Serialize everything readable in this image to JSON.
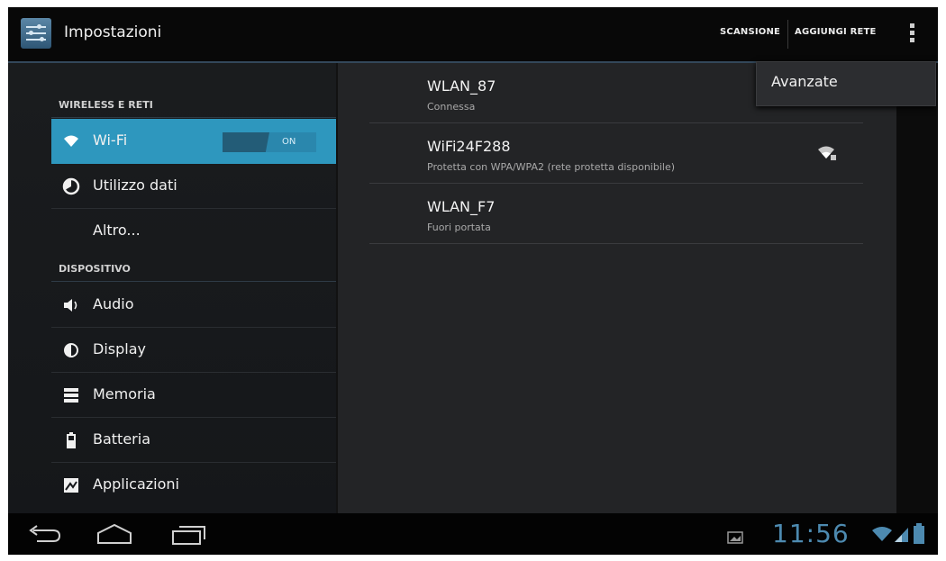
{
  "action_bar": {
    "title": "Impostazioni",
    "scan_label": "SCANSIONE",
    "add_network_label": "AGGIUNGI RETE",
    "icons": [
      "settings-app-icon",
      "overflow-menu-icon"
    ]
  },
  "overflow_menu": {
    "items": [
      {
        "label": "Avanzate"
      }
    ]
  },
  "sidebar": {
    "section_wireless": "WIRELESS E RETI",
    "section_device": "DISPOSITIVO",
    "items": [
      {
        "label": "Wi-Fi",
        "icon": "wifi-icon",
        "selected": true,
        "toggle": "ON"
      },
      {
        "label": "Utilizzo dati",
        "icon": "data-usage-icon"
      },
      {
        "label": "Altro..."
      },
      {
        "label": "Audio",
        "icon": "speaker-icon"
      },
      {
        "label": "Display",
        "icon": "brightness-icon"
      },
      {
        "label": "Memoria",
        "icon": "storage-icon"
      },
      {
        "label": "Batteria",
        "icon": "battery-icon"
      },
      {
        "label": "Applicazioni",
        "icon": "apps-icon"
      }
    ]
  },
  "networks": [
    {
      "ssid": "WLAN_87",
      "status": "Connessa"
    },
    {
      "ssid": "WiFi24F288",
      "status": "Protetta con WPA/WPA2 (rete protetta disponibile)",
      "icon": "wifi-signal-lock-icon"
    },
    {
      "ssid": "WLAN_F7",
      "status": "Fuori portata"
    }
  ],
  "status_bar": {
    "time": "11:56",
    "nav_icons": [
      "back-icon",
      "home-icon",
      "recent-apps-icon"
    ],
    "status_icons": [
      "notification-image-icon",
      "wifi-status-icon",
      "cell-signal-icon",
      "battery-status-icon"
    ],
    "accent_color": "#4d8ab0"
  },
  "colors": {
    "selected_item": "#2e97be",
    "background": "#0c0c0c"
  }
}
